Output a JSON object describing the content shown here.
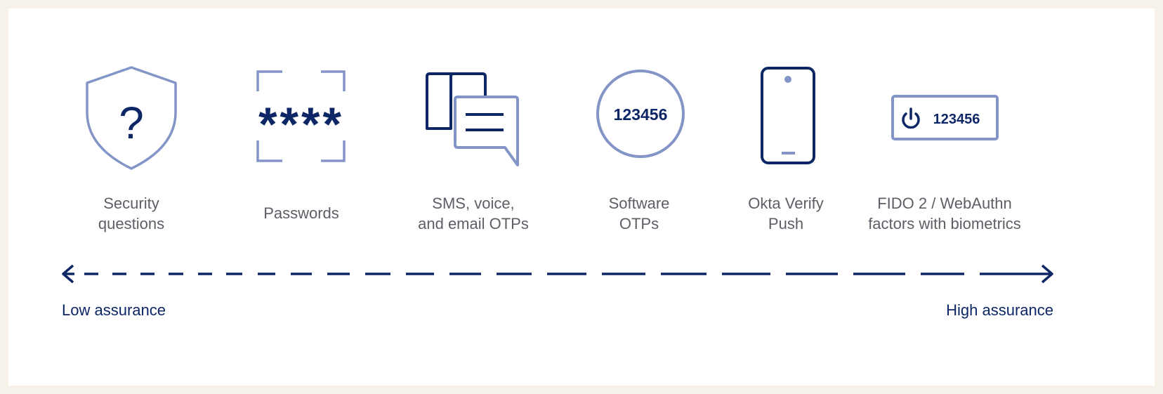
{
  "colors": {
    "background": "#f6f2e9",
    "card": "#ffffff",
    "icon_light": "#8394c7",
    "icon_dark": "#0d2766",
    "label_text": "#5c5f66"
  },
  "factors": [
    {
      "icon": "shield-question-icon",
      "glyph": "?",
      "label": "Security\nquestions"
    },
    {
      "icon": "password-icon",
      "glyph": "****",
      "label": "Passwords"
    },
    {
      "icon": "chat-bubbles-icon",
      "label": "SMS, voice,\nand email OTPs"
    },
    {
      "icon": "otp-circle-icon",
      "code": "123456",
      "label": "Software\nOTPs"
    },
    {
      "icon": "phone-icon",
      "label": "Okta Verify\nPush"
    },
    {
      "icon": "security-key-icon",
      "code": "123456",
      "label": "FIDO 2 / WebAuthn\nfactors with biometrics"
    }
  ],
  "scale": {
    "low_label": "Low assurance",
    "high_label": "High assurance"
  }
}
